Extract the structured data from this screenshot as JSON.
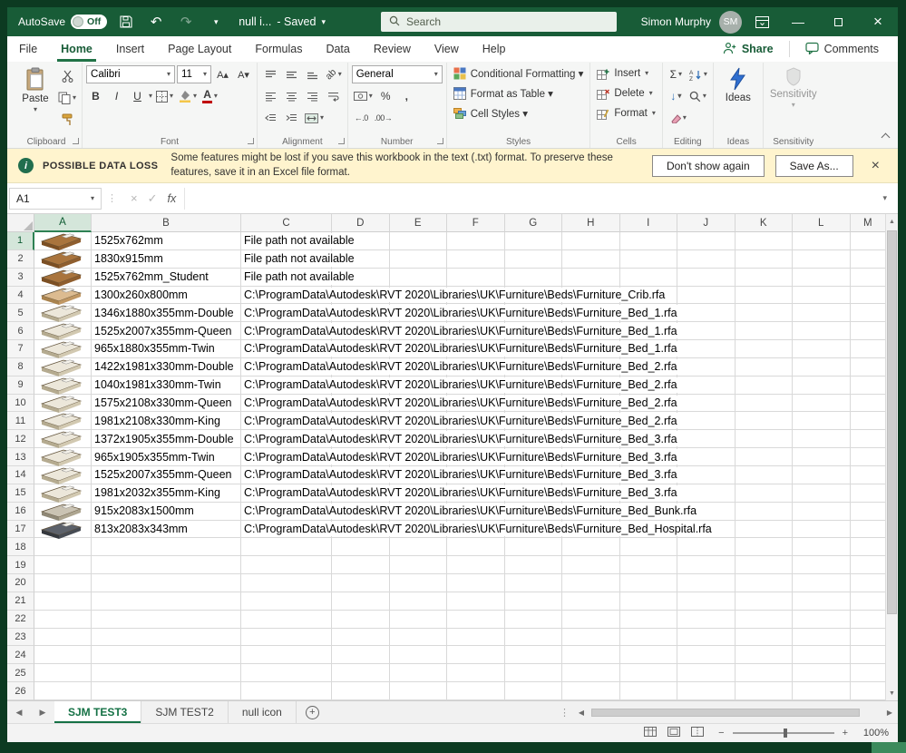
{
  "titlebar": {
    "autosave_label": "AutoSave",
    "autosave_state": "Off",
    "doc_title": "null i...",
    "doc_status": "- Saved",
    "search_placeholder": "Search",
    "user_name": "Simon Murphy",
    "user_initials": "SM"
  },
  "icons": {
    "dropdown": "▾",
    "undo": "↶",
    "redo": "↷",
    "close": "×",
    "minimize": "—",
    "check": "✓",
    "fx": "fx",
    "sigma": "Σ",
    "percent": "%",
    "comma": ",",
    "bold": "B",
    "italic": "I",
    "underline": "U",
    "font_grow": "A▴",
    "font_shrink": "A▾",
    "orientation": "ab",
    "decimal_increase": "←.0",
    "decimal_decrease": ".00→",
    "fill_down": "↓",
    "up_arrow": "▲",
    "down_arrow": "▼",
    "left_arrow": "◀",
    "right_arrow": "▶",
    "plus": "+",
    "minus": "−",
    "vdots": "⋮",
    "info": "i"
  },
  "ribbon": {
    "tabs": [
      {
        "label": "File",
        "active": false
      },
      {
        "label": "Home",
        "active": true
      },
      {
        "label": "Insert",
        "active": false
      },
      {
        "label": "Page Layout",
        "active": false
      },
      {
        "label": "Formulas",
        "active": false
      },
      {
        "label": "Data",
        "active": false
      },
      {
        "label": "Review",
        "active": false
      },
      {
        "label": "View",
        "active": false
      },
      {
        "label": "Help",
        "active": false
      }
    ],
    "share_label": "Share",
    "comments_label": "Comments",
    "clipboard": {
      "group": "Clipboard",
      "paste": "Paste"
    },
    "font": {
      "group": "Font",
      "family": "Calibri",
      "size": "11"
    },
    "alignment": {
      "group": "Alignment"
    },
    "number": {
      "group": "Number",
      "format": "General"
    },
    "styles": {
      "group": "Styles",
      "conditional": "Conditional Formatting ▾",
      "format_table": "Format as Table ▾",
      "cell_styles": "Cell Styles ▾"
    },
    "cells": {
      "group": "Cells",
      "insert": "Insert",
      "delete": "Delete",
      "format": "Format"
    },
    "editing": {
      "group": "Editing"
    },
    "ideas": {
      "group": "Ideas",
      "button": "Ideas"
    },
    "sensitivity": {
      "group": "Sensitivity",
      "button": "Sensitivity"
    }
  },
  "warning_bar": {
    "title": "POSSIBLE DATA LOSS",
    "message": "Some features might be lost if you save this workbook in the text (.txt) format. To preserve these features, save it in an Excel file format.",
    "dont_show_button": "Don't show again",
    "save_as_button": "Save As..."
  },
  "formula_bar": {
    "name_box": "A1",
    "value": ""
  },
  "grid": {
    "columns": [
      "A",
      "B",
      "C",
      "D",
      "E",
      "F",
      "G",
      "H",
      "I",
      "J",
      "K",
      "L",
      "M"
    ],
    "row_count": 26,
    "selected_cell": "A1",
    "rows": [
      {
        "n": 1,
        "icon": "wood-bed-thumbnail",
        "b": "1525x762mm",
        "c": "File path not available"
      },
      {
        "n": 2,
        "icon": "wood-bed-thumbnail",
        "b": "1830x915mm",
        "c": "File path not available"
      },
      {
        "n": 3,
        "icon": "wood-bed-thumbnail",
        "b": "1525x762mm_Student",
        "c": "File path not available"
      },
      {
        "n": 4,
        "icon": "crib-thumbnail",
        "b": "1300x260x800mm",
        "c": "C:\\ProgramData\\Autodesk\\RVT 2020\\Libraries\\UK\\Furniture\\Beds\\Furniture_Crib.rfa"
      },
      {
        "n": 5,
        "icon": "bed-thumbnail",
        "b": "1346x1880x355mm-Double",
        "c": "C:\\ProgramData\\Autodesk\\RVT 2020\\Libraries\\UK\\Furniture\\Beds\\Furniture_Bed_1.rfa"
      },
      {
        "n": 6,
        "icon": "bed-thumbnail",
        "b": "1525x2007x355mm-Queen",
        "c": "C:\\ProgramData\\Autodesk\\RVT 2020\\Libraries\\UK\\Furniture\\Beds\\Furniture_Bed_1.rfa"
      },
      {
        "n": 7,
        "icon": "bed-thumbnail",
        "b": "965x1880x355mm-Twin",
        "c": "C:\\ProgramData\\Autodesk\\RVT 2020\\Libraries\\UK\\Furniture\\Beds\\Furniture_Bed_1.rfa"
      },
      {
        "n": 8,
        "icon": "bed-thumbnail",
        "b": "1422x1981x330mm-Double",
        "c": "C:\\ProgramData\\Autodesk\\RVT 2020\\Libraries\\UK\\Furniture\\Beds\\Furniture_Bed_2.rfa"
      },
      {
        "n": 9,
        "icon": "bed-thumbnail",
        "b": "1040x1981x330mm-Twin",
        "c": "C:\\ProgramData\\Autodesk\\RVT 2020\\Libraries\\UK\\Furniture\\Beds\\Furniture_Bed_2.rfa"
      },
      {
        "n": 10,
        "icon": "bed-thumbnail",
        "b": "1575x2108x330mm-Queen",
        "c": "C:\\ProgramData\\Autodesk\\RVT 2020\\Libraries\\UK\\Furniture\\Beds\\Furniture_Bed_2.rfa"
      },
      {
        "n": 11,
        "icon": "bed-thumbnail",
        "b": "1981x2108x330mm-King",
        "c": "C:\\ProgramData\\Autodesk\\RVT 2020\\Libraries\\UK\\Furniture\\Beds\\Furniture_Bed_2.rfa"
      },
      {
        "n": 12,
        "icon": "bed-thumbnail",
        "b": "1372x1905x355mm-Double",
        "c": "C:\\ProgramData\\Autodesk\\RVT 2020\\Libraries\\UK\\Furniture\\Beds\\Furniture_Bed_3.rfa"
      },
      {
        "n": 13,
        "icon": "bed-thumbnail",
        "b": "965x1905x355mm-Twin",
        "c": "C:\\ProgramData\\Autodesk\\RVT 2020\\Libraries\\UK\\Furniture\\Beds\\Furniture_Bed_3.rfa"
      },
      {
        "n": 14,
        "icon": "bed-thumbnail",
        "b": "1525x2007x355mm-Queen",
        "c": "C:\\ProgramData\\Autodesk\\RVT 2020\\Libraries\\UK\\Furniture\\Beds\\Furniture_Bed_3.rfa"
      },
      {
        "n": 15,
        "icon": "bed-thumbnail",
        "b": "1981x2032x355mm-King",
        "c": "C:\\ProgramData\\Autodesk\\RVT 2020\\Libraries\\UK\\Furniture\\Beds\\Furniture_Bed_3.rfa"
      },
      {
        "n": 16,
        "icon": "bunk-bed-thumbnail",
        "b": "915x2083x1500mm",
        "c": "C:\\ProgramData\\Autodesk\\RVT 2020\\Libraries\\UK\\Furniture\\Beds\\Furniture_Bed_Bunk.rfa"
      },
      {
        "n": 17,
        "icon": "hospital-bed-thumbnail",
        "b": "813x2083x343mm",
        "c": "C:\\ProgramData\\Autodesk\\RVT 2020\\Libraries\\UK\\Furniture\\Beds\\Furniture_Bed_Hospital.rfa"
      }
    ]
  },
  "sheet_tabs": {
    "tabs": [
      {
        "label": "SJM TEST3",
        "active": true
      },
      {
        "label": "SJM TEST2",
        "active": false
      },
      {
        "label": "null icon",
        "active": false
      }
    ]
  },
  "status_bar": {
    "zoom": "100%"
  }
}
